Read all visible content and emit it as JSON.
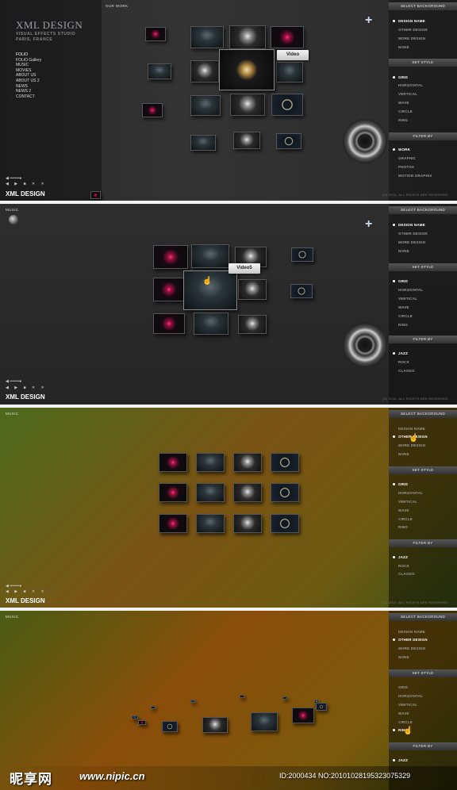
{
  "brand": {
    "title": "XML DESIGN",
    "subtitle_1": "VISUAL EFFECTS STUDIO",
    "subtitle_2": "PARIS, FRANCE",
    "footer_title": "XML DESIGN"
  },
  "menu_items": [
    "FOLIO",
    "FOLIO Gallery",
    "MUSIC",
    "MOVIES",
    "ABOUT US",
    "ABOUT US 2",
    "NEWS",
    "NEWS 2",
    "CONTACT"
  ],
  "section_label_folio": "OUR WORK",
  "section_label_music": "MUSIC",
  "player_controls": "◀ ▶ ■ ✕ ✕",
  "volume": "◀ ━━━━●",
  "plus_symbol": "+",
  "sidebar": {
    "select_background": "SELECT BACKGROUND",
    "backgrounds": [
      "DESIGN NAME",
      "OTHER DESIGN",
      "MORE DESIGN",
      "NONE"
    ],
    "set_style": "SET STYLE",
    "styles": [
      "GRID",
      "HORIZONTAL",
      "VERTICAL",
      "WAVE",
      "CIRCLE",
      "RING"
    ],
    "filter_by": "FILTER BY",
    "filters_folio": [
      "WORK",
      "GRAPHIC",
      "PHOTOS",
      "MOTION GRAPHIX"
    ],
    "filters_music": [
      "JAZZ",
      "ROCK",
      "CLASSIC"
    ]
  },
  "copyright": "(C) 2011, ALL RIGHTS ARE RESERVED.",
  "tooltips": {
    "panel1": "Video",
    "panel2": "Video5"
  },
  "watermark": {
    "logo": "昵享网",
    "url": "www.nipic.cn",
    "id": "ID:2000434 NO:20101028195323075329"
  },
  "colors": {
    "panel_dark": "#2e2e2e",
    "panel_olive": "#6d5a12",
    "accent_white": "#ffffff",
    "sidebar_header": "#444444"
  }
}
